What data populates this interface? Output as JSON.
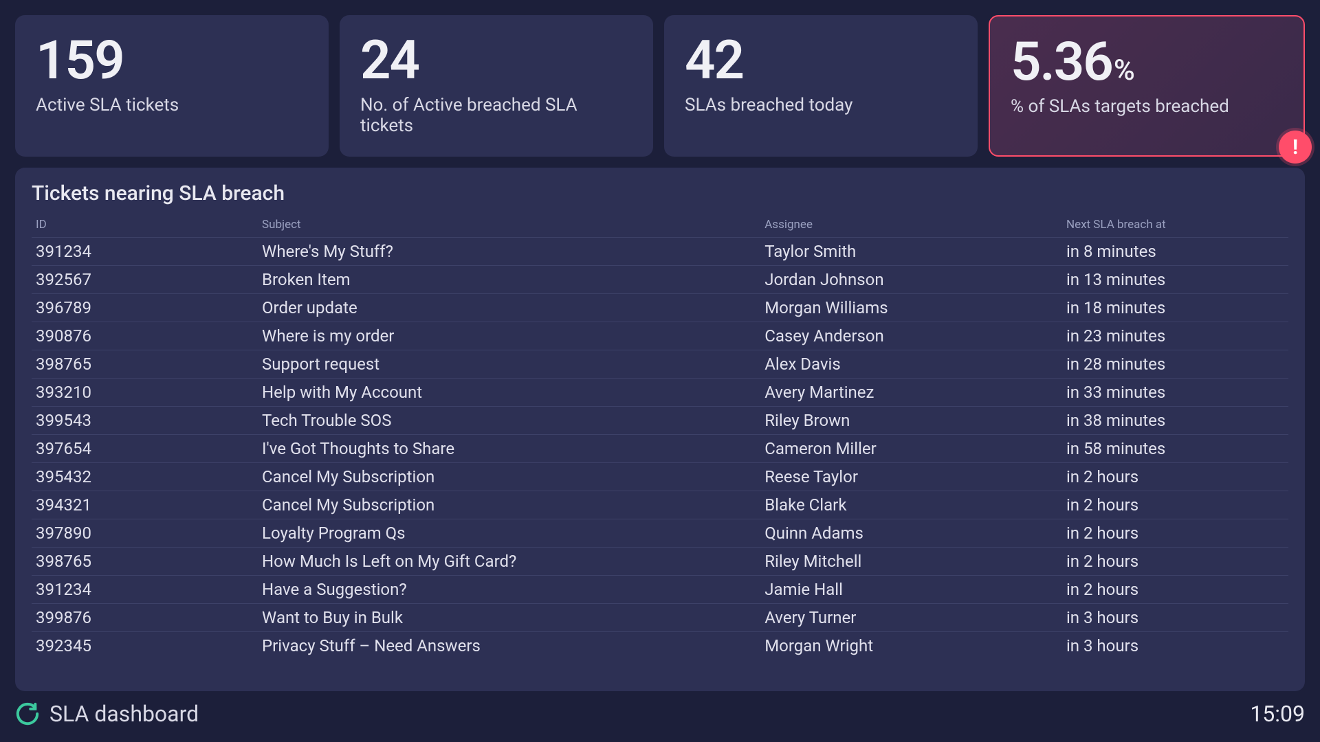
{
  "cards": [
    {
      "value": "159",
      "unit": "",
      "label": "Active SLA tickets",
      "alert": false
    },
    {
      "value": "24",
      "unit": "",
      "label": "No. of Active breached SLA tickets",
      "alert": false
    },
    {
      "value": "42",
      "unit": "",
      "label": "SLAs breached today",
      "alert": false
    },
    {
      "value": "5.36",
      "unit": "%",
      "label": "% of SLAs targets breached",
      "alert": true
    }
  ],
  "table": {
    "title": "Tickets nearing SLA breach",
    "columns": [
      "ID",
      "Subject",
      "Assignee",
      "Next SLA breach at"
    ],
    "rows": [
      {
        "id": "391234",
        "subject": "Where's My Stuff?",
        "assignee": "Taylor Smith",
        "breach": "in 8 minutes"
      },
      {
        "id": "392567",
        "subject": "Broken Item",
        "assignee": "Jordan Johnson",
        "breach": "in 13 minutes"
      },
      {
        "id": "396789",
        "subject": "Order update",
        "assignee": "Morgan Williams",
        "breach": "in 18 minutes"
      },
      {
        "id": "390876",
        "subject": "Where is my order",
        "assignee": "Casey Anderson",
        "breach": "in 23 minutes"
      },
      {
        "id": "398765",
        "subject": "Support request",
        "assignee": "Alex Davis",
        "breach": "in 28 minutes"
      },
      {
        "id": "393210",
        "subject": "Help with My Account",
        "assignee": "Avery Martinez",
        "breach": "in 33 minutes"
      },
      {
        "id": "399543",
        "subject": "Tech Trouble SOS",
        "assignee": "Riley Brown",
        "breach": "in 38 minutes"
      },
      {
        "id": "397654",
        "subject": "I've Got Thoughts to Share",
        "assignee": "Cameron Miller",
        "breach": "in 58 minutes"
      },
      {
        "id": "395432",
        "subject": "Cancel My Subscription",
        "assignee": "Reese Taylor",
        "breach": "in 2 hours"
      },
      {
        "id": "394321",
        "subject": "Cancel My Subscription",
        "assignee": "Blake Clark",
        "breach": "in 2 hours"
      },
      {
        "id": "397890",
        "subject": "Loyalty Program Qs",
        "assignee": "Quinn Adams",
        "breach": "in 2 hours"
      },
      {
        "id": "398765",
        "subject": "How Much Is Left on My Gift Card?",
        "assignee": "Riley Mitchell",
        "breach": "in 2 hours"
      },
      {
        "id": "391234",
        "subject": "Have a Suggestion?",
        "assignee": "Jamie Hall",
        "breach": "in 2 hours"
      },
      {
        "id": "399876",
        "subject": "Want to Buy in Bulk",
        "assignee": "Avery Turner",
        "breach": "in 3 hours"
      },
      {
        "id": "392345",
        "subject": "Privacy Stuff – Need Answers",
        "assignee": "Morgan Wright",
        "breach": "in 3 hours"
      }
    ]
  },
  "footer": {
    "title": "SLA dashboard",
    "time": "15:09"
  },
  "colors": {
    "bg": "#1c1f3a",
    "card": "#2d3054",
    "alert_border": "#ff4d6a",
    "accent": "#3cc99e"
  }
}
